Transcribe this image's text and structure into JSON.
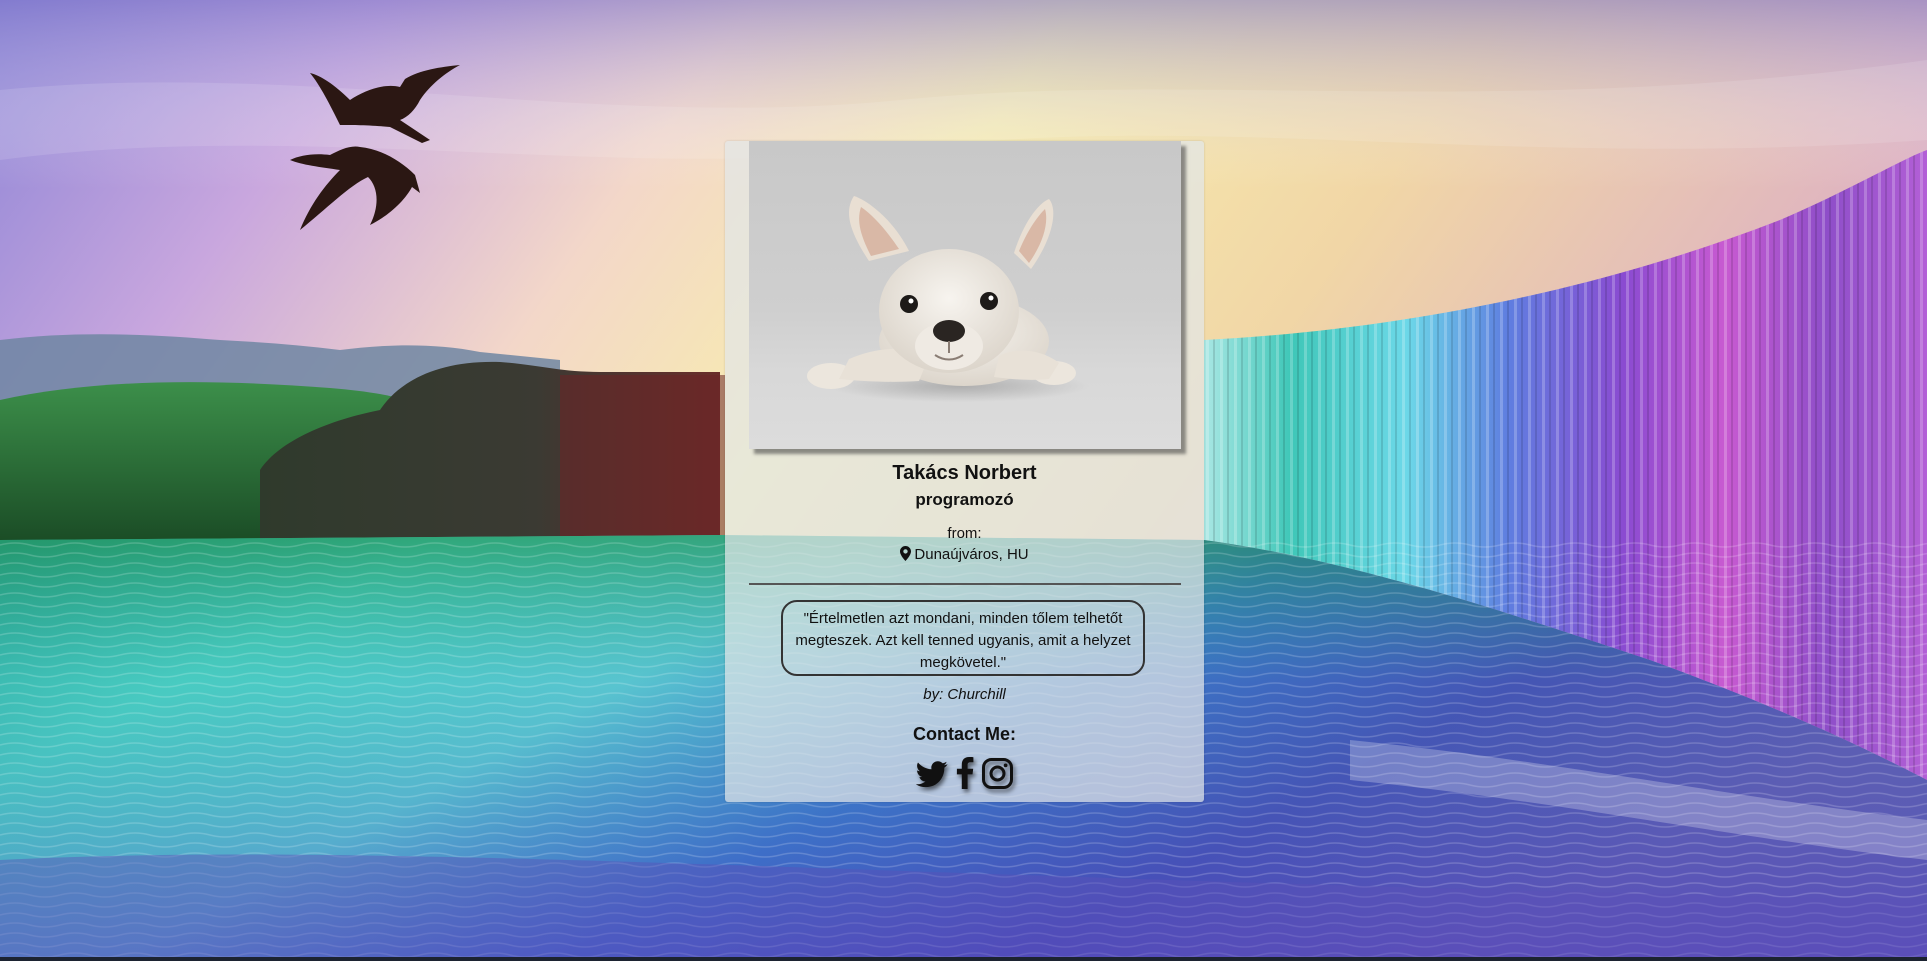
{
  "profile": {
    "name": "Takács Norbert",
    "role": "programozó",
    "from_label": "from:",
    "location": "Dunaújváros, HU"
  },
  "quote": {
    "text": "\"Értelmetlen azt mondani, minden tőlem telhetőt megteszek. Azt kell tenned ugyanis, amit a helyzet megkövetel.\"",
    "author": "by: Churchill"
  },
  "contact": {
    "heading": "Contact Me:",
    "links": [
      {
        "icon": "twitter-icon"
      },
      {
        "icon": "facebook-icon"
      },
      {
        "icon": "instagram-icon"
      }
    ]
  },
  "colors": {
    "card_background": "#e2e6e8",
    "text": "#111111",
    "divider": "#555555"
  }
}
